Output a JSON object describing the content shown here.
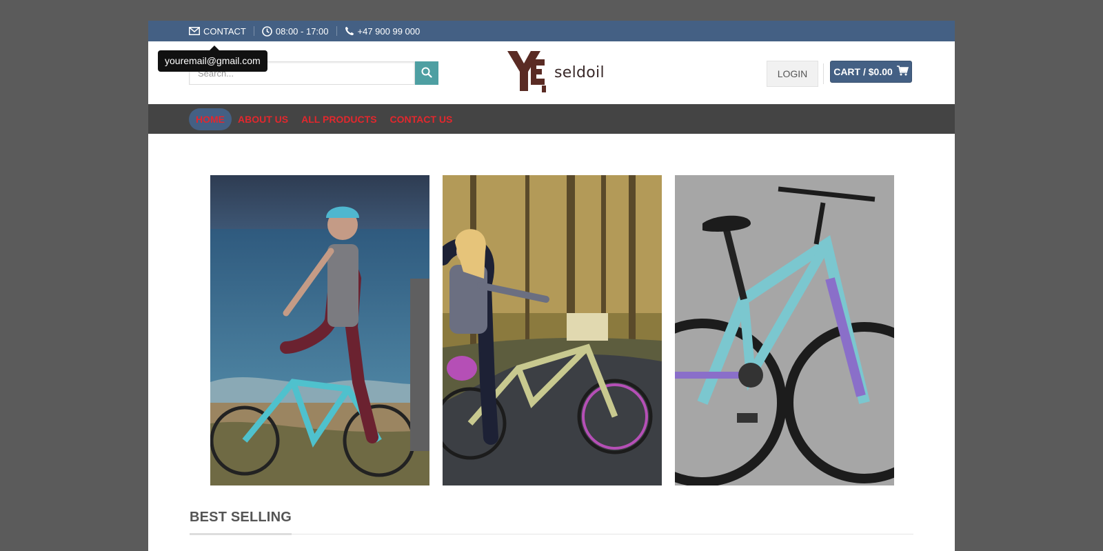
{
  "topbar": {
    "contact_label": "CONTACT",
    "hours": "08:00 - 17:00",
    "phone": "+47 900 99 000",
    "contact_tooltip": "youremail@gmail.com"
  },
  "header": {
    "search_placeholder": "Search...",
    "logo_text": "seldoil",
    "login_label": "LOGIN",
    "cart_label": "CART / $0.00"
  },
  "nav": {
    "items": [
      {
        "label": "HOME",
        "active": true
      },
      {
        "label": "ABOUT US"
      },
      {
        "label": "ALL PRODUCTS"
      },
      {
        "label": "CONTACT US"
      }
    ]
  },
  "gallery": {
    "tiles": [
      {
        "name": "woman-riding-bike-beach-image"
      },
      {
        "name": "woman-with-cruiser-bike-forest-image"
      },
      {
        "name": "teal-kids-mountain-bike-image"
      }
    ]
  },
  "sections": {
    "best_selling_title": "BEST SELLING"
  },
  "colors": {
    "primary": "#446084",
    "nav_bg": "#444444",
    "nav_link": "#e3272d",
    "search_button": "#4e9fa2",
    "backdrop": "#5b5b5b"
  },
  "icons": {
    "contact": "envelope-icon",
    "hours": "clock-icon",
    "phone": "phone-icon",
    "search": "search-icon",
    "cart": "cart-icon"
  }
}
